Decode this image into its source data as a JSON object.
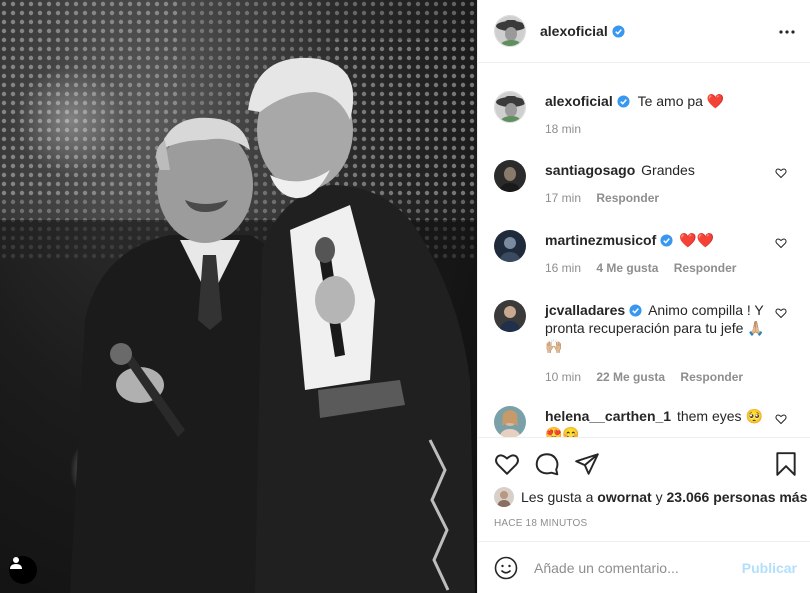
{
  "post": {
    "author": "alexoficial",
    "verified": true,
    "photo_alt": "",
    "icons": {
      "verified": "verified-badge-icon",
      "more": "more-options-icon",
      "tag": "user-tag-icon",
      "like": "heart-icon",
      "comment": "comment-bubble-icon",
      "share": "paper-plane-icon",
      "save": "bookmark-icon",
      "emoji": "emoji-smiley-icon"
    },
    "colors": {
      "link": "#0095f6",
      "publish_disabled": "#b2dffc",
      "muted": "#8e8e8e",
      "heart": "#ed4956"
    }
  },
  "caption": {
    "username": "alexoficial",
    "text": "Te amo pa ❤️",
    "time": "18 min"
  },
  "comments": [
    {
      "username": "santiagosago",
      "text": "Grandes",
      "time": "17 min",
      "likes": "",
      "reply": "Responder"
    },
    {
      "username": "martinezmusicof",
      "text": "❤️❤️",
      "time": "16 min",
      "likes": "4 Me gusta",
      "reply": "Responder"
    },
    {
      "username": "jcvalladares",
      "text": "Animo compilla ! Y pronta recuperación para tu jefe 🙏🏼🙌🏼",
      "time": "10 min",
      "likes": "22 Me gusta",
      "reply": "Responder"
    },
    {
      "username": "helena__carthen_1",
      "text": "them eyes 🥺 😍😊",
      "time": "",
      "likes": "",
      "reply": ""
    }
  ],
  "likes_summary": {
    "prefix": "Les gusta a",
    "user": "owornat",
    "middle": "y",
    "count": "23.066 personas más"
  },
  "timestamp": "HACE 18 MINUTOS",
  "add_comment": {
    "placeholder": "Añade un comentario...",
    "publish_label": "Publicar"
  }
}
